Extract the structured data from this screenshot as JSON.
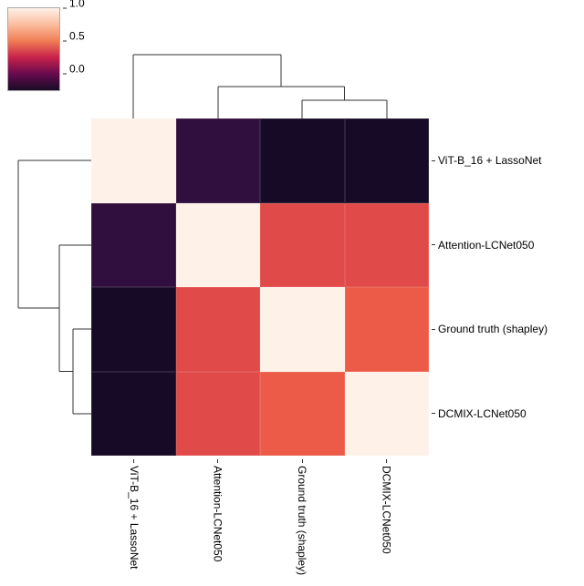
{
  "colorbar": {
    "ticks": [
      {
        "pos": 0,
        "label": "1.0"
      },
      {
        "pos": 40,
        "label": "0.5"
      },
      {
        "pos": 80,
        "label": "0.0"
      }
    ]
  },
  "chart_data": {
    "type": "heatmap",
    "row_labels": [
      "ViT-B_16 + LassoNet",
      "Attention-LCNet050",
      "Ground truth (shapley)",
      "DCMIX-LCNet050"
    ],
    "col_labels": [
      "ViT-B_16 + LassoNet",
      "Attention-LCNet050",
      "Ground truth (shapley)",
      "DCMIX-LCNet050"
    ],
    "values": [
      [
        1.0,
        -0.05,
        -0.2,
        -0.2
      ],
      [
        -0.05,
        1.0,
        0.55,
        0.55
      ],
      [
        -0.2,
        0.55,
        1.0,
        0.6
      ],
      [
        -0.2,
        0.55,
        0.6,
        1.0
      ]
    ],
    "vmin": -0.25,
    "vmax": 1.0,
    "cmap": "rocket_r"
  }
}
